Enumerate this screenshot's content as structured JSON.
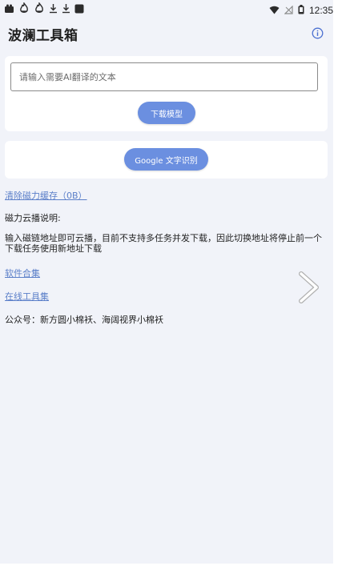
{
  "status_bar": {
    "time": "12:35",
    "left_icons": [
      "app-notification-icon",
      "fire-icon",
      "fire-icon",
      "download-icon",
      "download-icon",
      "square-icon"
    ],
    "right_icons": [
      "wifi-icon",
      "signal-off-icon",
      "battery-icon"
    ]
  },
  "app_bar": {
    "title": "波澜工具箱",
    "info_icon": "info-icon"
  },
  "translate": {
    "placeholder": "请输入需要AI翻译的文本",
    "value": "",
    "download_label": "下载模型"
  },
  "ocr": {
    "label": "Google 文字识别"
  },
  "content": {
    "clear_cache": "清除磁力缓存（0B）",
    "magnet_heading": "磁力云播说明:",
    "magnet_desc": "输入磁链地址即可云播，目前不支持多任务并发下载，因此切换地址将停止前一个下载任务使用新地址下载",
    "software_link": "软件合集",
    "online_tools_link": "在线工具集",
    "wechat": "公众号：新方圆小棉袄、海阔视界小棉袄"
  },
  "colors": {
    "accent": "#6b8fe0",
    "link": "#5b7fc9",
    "background": "#f1f3f9",
    "card": "#ffffff"
  }
}
